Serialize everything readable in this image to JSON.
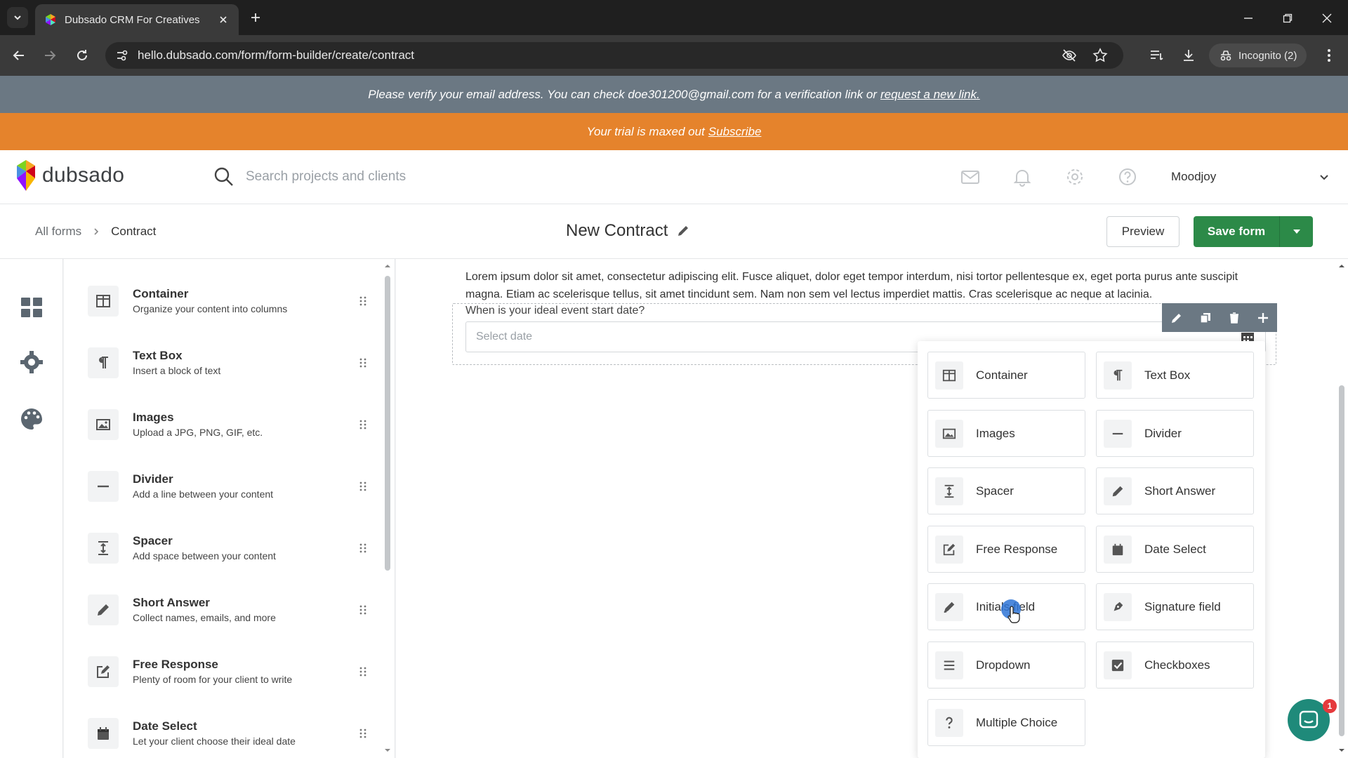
{
  "browser": {
    "tab_title": "Dubsado CRM For Creatives",
    "url": "hello.dubsado.com/form/form-builder/create/contract",
    "incognito_label": "Incognito (2)"
  },
  "banners": {
    "verify_text": "Please verify your email address. You can check doe301200@gmail.com for a verification link or",
    "verify_link": "request a new link.",
    "trial_text": "Your trial is maxed out",
    "trial_link": "Subscribe"
  },
  "header": {
    "logo_text": "dubsado",
    "search_placeholder": "Search projects and clients",
    "user_name": "Moodjoy"
  },
  "subheader": {
    "breadcrumb_root": "All forms",
    "breadcrumb_current": "Contract",
    "form_title": "New Contract",
    "preview_label": "Preview",
    "save_label": "Save form"
  },
  "elements": [
    {
      "name": "Container",
      "desc": "Organize your content into columns",
      "icon": "container-icon"
    },
    {
      "name": "Text Box",
      "desc": "Insert a block of text",
      "icon": "paragraph-icon"
    },
    {
      "name": "Images",
      "desc": "Upload a JPG, PNG, GIF, etc.",
      "icon": "image-icon"
    },
    {
      "name": "Divider",
      "desc": "Add a line between your content",
      "icon": "divider-icon"
    },
    {
      "name": "Spacer",
      "desc": "Add space between your content",
      "icon": "spacer-icon"
    },
    {
      "name": "Short Answer",
      "desc": "Collect names, emails, and more",
      "icon": "pencil-icon"
    },
    {
      "name": "Free Response",
      "desc": "Plenty of room for your client to write",
      "icon": "edit-icon"
    },
    {
      "name": "Date Select",
      "desc": "Let your client choose their ideal date",
      "icon": "calendar-icon"
    }
  ],
  "canvas": {
    "lorem": "Lorem ipsum dolor sit amet, consectetur adipiscing elit. Fusce aliquet, dolor eget tempor interdum, nisi tortor pellentesque ex, eget porta purus ante suscipit magna. Etiam ac scelerisque tellus, sit amet tincidunt sem. Nam non sem vel lectus imperdiet mattis. Cras scelerisque ac neque at lacinia.",
    "field_label": "When is your ideal event start date?",
    "date_placeholder": "Select date"
  },
  "popover": {
    "items": [
      {
        "label": "Container",
        "icon": "container-icon"
      },
      {
        "label": "Text Box",
        "icon": "paragraph-icon"
      },
      {
        "label": "Images",
        "icon": "image-icon"
      },
      {
        "label": "Divider",
        "icon": "divider-icon"
      },
      {
        "label": "Spacer",
        "icon": "spacer-icon"
      },
      {
        "label": "Short Answer",
        "icon": "pencil-icon"
      },
      {
        "label": "Free Response",
        "icon": "edit-icon"
      },
      {
        "label": "Date Select",
        "icon": "calendar-icon"
      },
      {
        "label": "Initials field",
        "icon": "initials-pen-icon"
      },
      {
        "label": "Signature field",
        "icon": "signature-pen-icon"
      },
      {
        "label": "Dropdown",
        "icon": "dropdown-list-icon"
      },
      {
        "label": "Checkboxes",
        "icon": "checkbox-icon"
      },
      {
        "label": "Multiple Choice",
        "icon": "question-mark-icon"
      }
    ]
  },
  "chat": {
    "badge_count": "1"
  },
  "colors": {
    "primary_green": "#2c8a48",
    "trial_orange": "#e5832c",
    "banner_gray": "#6b7883"
  }
}
